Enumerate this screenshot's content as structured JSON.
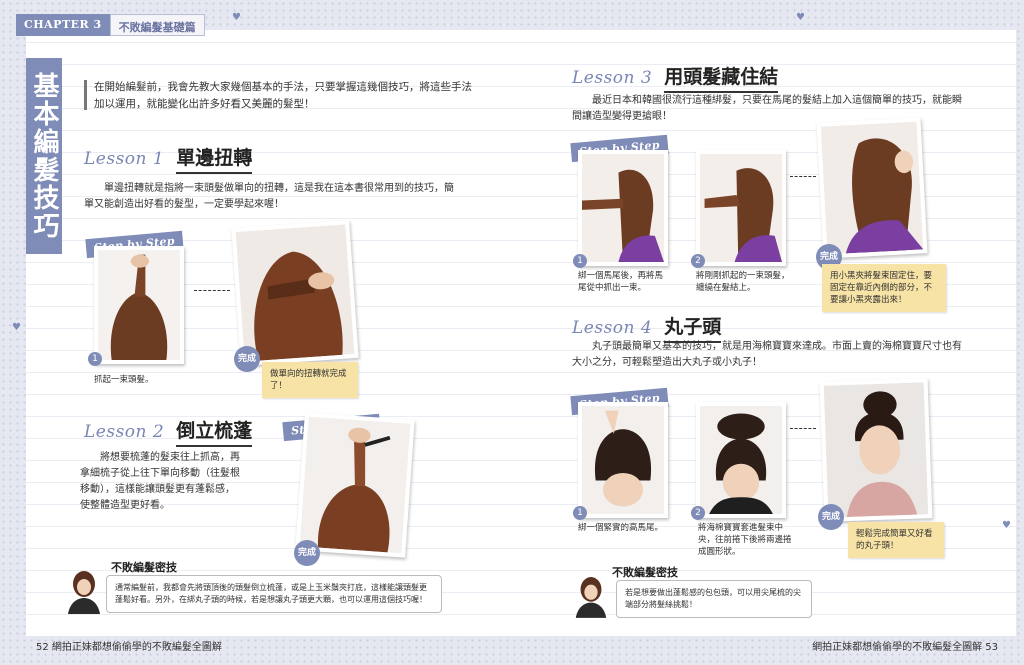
{
  "header": {
    "chapter": "CHAPTER 3",
    "subtitle": "不敗編髮基礎篇"
  },
  "page_title": "基本編髮技巧",
  "intro": "在開始編髮前，我會先教大家幾個基本的手法，只要掌握這幾個技巧，將這些手法加以運用，就能變化出許多好看又美麗的髮型！",
  "step_by_step_label": "Step by Step",
  "done_label": "完成",
  "lessons": {
    "l1": {
      "en": "Lesson 1",
      "title": "單邊扭轉",
      "body": "單邊扭轉就是指將一束頭髮做單向的扭轉，這是我在這本書很常用到的技巧，簡單又能創造出好看的髮型，一定要學起來喔！",
      "step1_num": "1",
      "step1_caption": "抓起一束頭髮。",
      "done_note": "做單向的扭轉就完成了！"
    },
    "l2": {
      "en": "Lesson 2",
      "title": "倒立梳蓬",
      "body": "將想要梳蓬的髮束往上抓高，再拿細梳子從上往下單向移動（往髮根移動），這樣能讓頭髮更有蓬鬆感，使整體造型更好看。"
    },
    "l3": {
      "en": "Lesson 3",
      "title": "用頭髮藏住結",
      "body": "最近日本和韓國很流行這種綁髮，只要在馬尾的髮結上加入這個簡單的技巧，就能瞬間讓造型變得更搶眼！",
      "step1_num": "1",
      "step1_caption": "綁一個馬尾後，再將馬尾從中抓出一束。",
      "step2_num": "2",
      "step2_caption": "將剛剛抓起的一束頭髮，纏繞在髮結上。",
      "done_note": "用小黑夾將髮束固定住，要固定在靠近內側的部分，不要讓小黑夾露出來！"
    },
    "l4": {
      "en": "Lesson 4",
      "title": "丸子頭",
      "body": "丸子頭最簡單又基本的技巧，就是用海棉寶寶來達成。市面上賣的海棉寶寶尺寸也有大小之分，可輕鬆塑造出大丸子或小丸子！",
      "step1_num": "1",
      "step1_caption": "綁一個緊實的高馬尾。",
      "step2_num": "2",
      "step2_caption": "將海棉寶寶套進髮束中央，往前捲下後將兩邊捲成圓形狀。",
      "done_note": "輕鬆完成簡單又好看的丸子頭！"
    }
  },
  "tips": [
    {
      "title": "不敗編髮密技",
      "text": "通常編髮前，我都會先將頭頂後的頭髮倒立梳蓬，或是上玉米鬚夾打底，這樣能讓頭髮更蓬鬆好看。另外，在綁丸子頭的時候，若是想讓丸子頭更大顆，也可以運用這個技巧喔！"
    },
    {
      "title": "不敗編髮密技",
      "text": "若是想要做出蓬鬆感的包包頭，可以用尖尾梳的尖端部分將髮絲挑鬆！"
    }
  ],
  "footer": {
    "left_num": "52",
    "left_text": "網拍正妹都想偷偷學的不敗編髮全圖解",
    "right_text": "網拍正妹都想偷偷學的不敗編髮全圖解",
    "right_num": "53"
  },
  "colors": {
    "accent": "#7f8cb7",
    "note": "#f7e3a6",
    "hair": "#6b3b22",
    "purple_top": "#7a3fa0"
  }
}
